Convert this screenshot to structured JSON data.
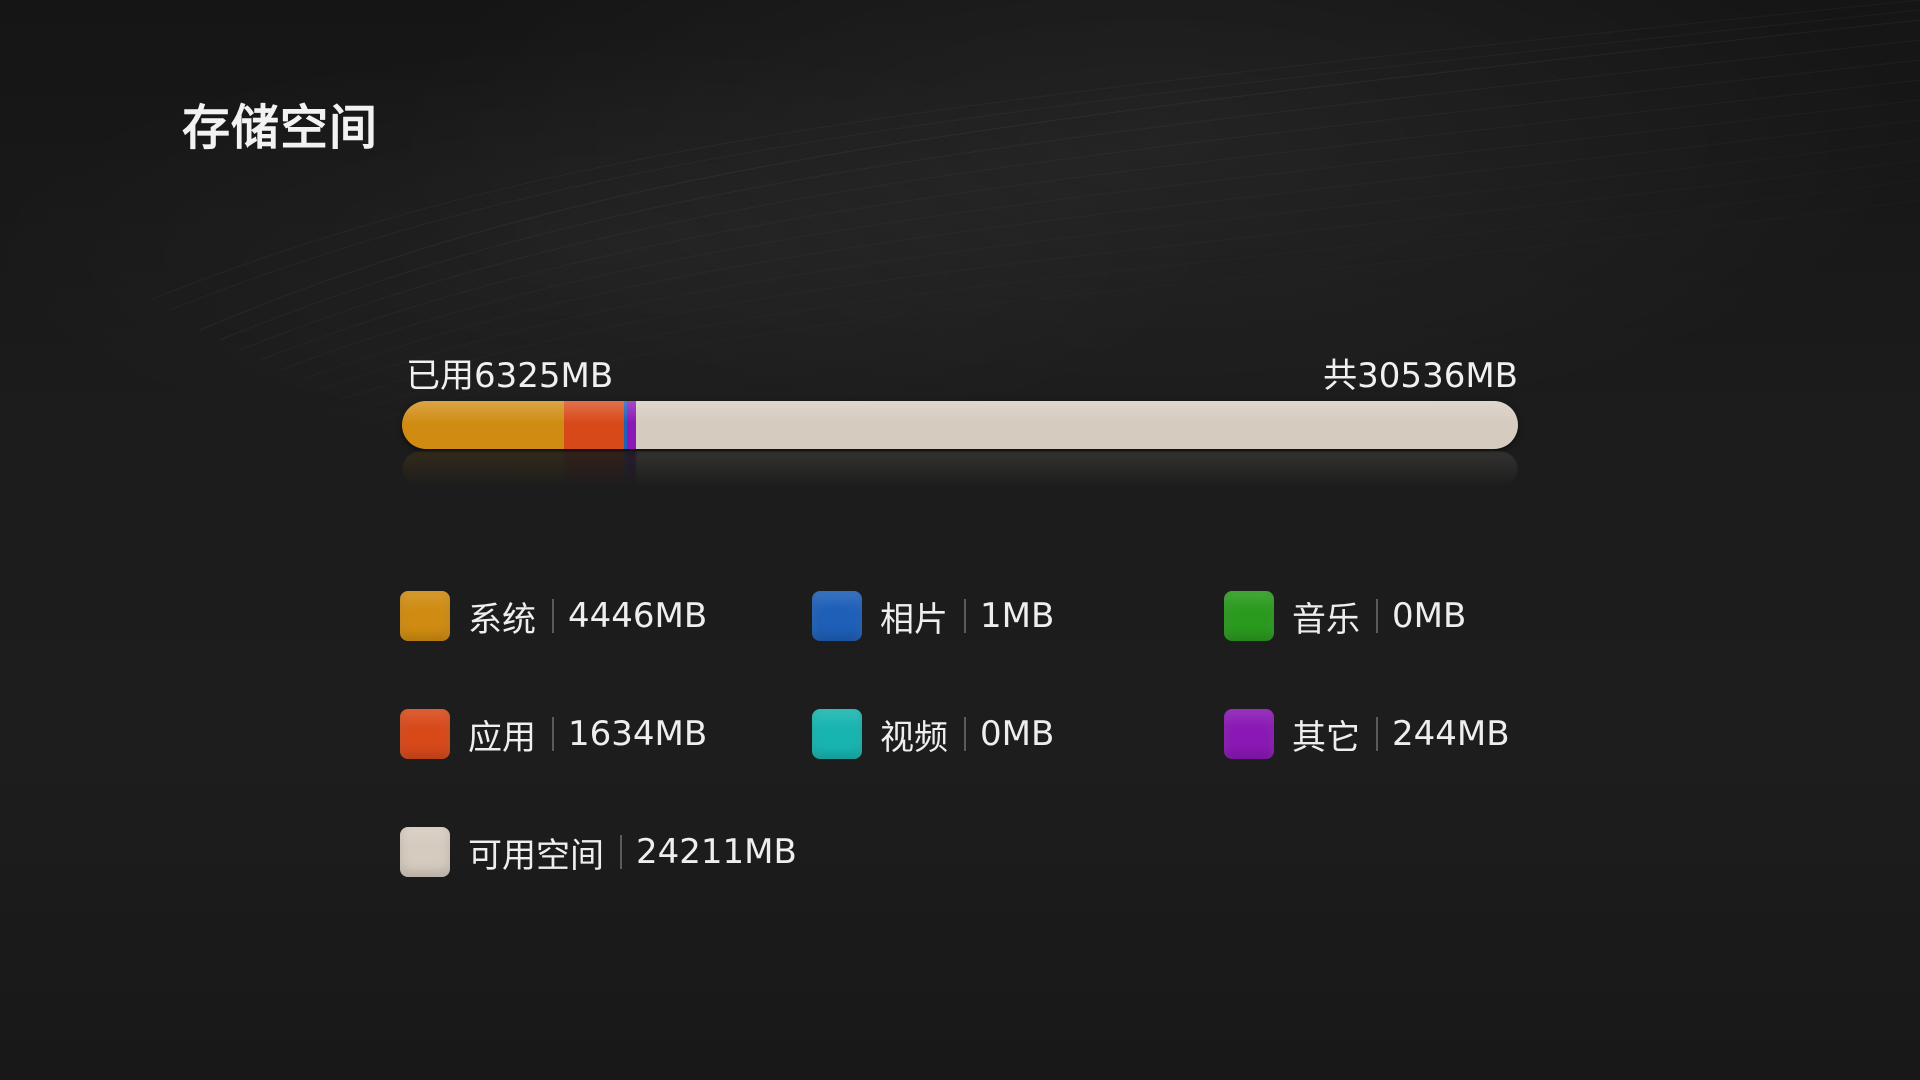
{
  "page": {
    "title": "存储空间"
  },
  "usage": {
    "used_label": "已用6325MB",
    "total_label": "共30536MB",
    "used_mb": 6325,
    "total_mb": 30536
  },
  "legend": {
    "system": {
      "name": "系统",
      "value": "4446MB",
      "mb": 4446,
      "color": "#d08c12"
    },
    "photos": {
      "name": "相片",
      "value": "1MB",
      "mb": 1,
      "color": "#1e5fb8"
    },
    "music": {
      "name": "音乐",
      "value": "0MB",
      "mb": 0,
      "color": "#2a9a1e"
    },
    "apps": {
      "name": "应用",
      "value": "1634MB",
      "mb": 1634,
      "color": "#d8491a"
    },
    "videos": {
      "name": "视频",
      "value": "0MB",
      "mb": 0,
      "color": "#18b5b0"
    },
    "other": {
      "name": "其它",
      "value": "244MB",
      "mb": 244,
      "color": "#8a18b5"
    },
    "free": {
      "name": "可用空间",
      "value": "24211MB",
      "mb": 24211,
      "color": "#d6cbbf"
    }
  },
  "bar_order": [
    "system",
    "apps",
    "photos",
    "music",
    "videos",
    "other",
    "free"
  ]
}
